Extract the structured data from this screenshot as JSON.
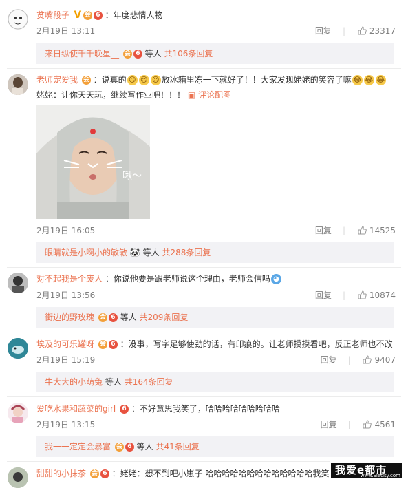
{
  "comments": [
    {
      "username": "贫嘴段子",
      "text": "：年度悲情人物",
      "date": "2月19日 13:11",
      "reply_label": "回复",
      "likes": "23317",
      "reply_preview": {
        "user": "来日纵使千千晚星__",
        "others": "等人",
        "count": "共106条回复"
      }
    },
    {
      "username": "老师宠爱我",
      "text_part1": "：说真的",
      "text_part2": "放冰箱里冻一下就好了！！大家发现姥姥的笑容了嘛",
      "line2": "姥姥：让你天天玩，继续写作业吧！！！",
      "pic_link": "评论配图",
      "photo_caption": "啾～",
      "date": "2月19日 16:05",
      "reply_label": "回复",
      "likes": "14525",
      "reply_preview": {
        "user": "眼睛就是小啊小的敏敏",
        "others": "等人",
        "count": "共288条回复"
      }
    },
    {
      "username": "对不起我是个废人",
      "text": "：你说他要是跟老师说这个理由，老师会信吗",
      "date": "2月19日 13:56",
      "reply_label": "回复",
      "likes": "10874",
      "reply_preview": {
        "user": "街边的野玫瑰",
        "others": "等人",
        "count": "共209条回复"
      }
    },
    {
      "username": "埃及的可乐罐呀",
      "text": "：没事，写字足够使劲的话，有印痕的。让老师摸摸看吧，反正老师也不改",
      "date": "2月19日 15:19",
      "reply_label": "回复",
      "likes": "9407",
      "reply_preview": {
        "user": "牛大大的小萌兔",
        "others": "等人",
        "count": "共164条回复"
      }
    },
    {
      "username": "爱吃水果和蔬菜的girl",
      "text": "：不好意思我笑了，哈哈哈哈哈哈哈哈哈",
      "date": "2月19日 13:15",
      "reply_label": "回复",
      "likes": "4561",
      "reply_preview": {
        "user": "我一一定定会暴富",
        "others": "等人",
        "count": "共41条回复"
      }
    },
    {
      "username": "甜甜的小抹茶",
      "text": "：姥姥：想不到吧小崽子 哈哈哈哈哈哈哈哈哈哈哈哈哈我笑吐了"
    }
  ],
  "watermark": {
    "big": "我爱e都市",
    "small": "www.Siecity.com"
  },
  "colors": {
    "accent": "#eb7350",
    "reply_bg": "#f2f2f5",
    "meta": "#808080"
  }
}
